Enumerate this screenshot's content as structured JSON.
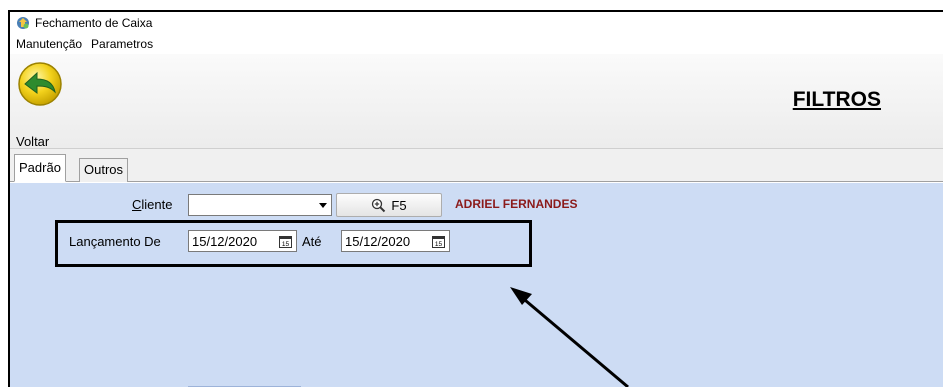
{
  "window": {
    "title": "Fechamento de Caixa"
  },
  "menu": {
    "items": [
      "Manutenção",
      "Parametros"
    ]
  },
  "toolbar": {
    "back_label": "Voltar",
    "back_icon": "back-arrow-icon",
    "page_title": "FILTROS"
  },
  "tabs": [
    {
      "label": "Padrão",
      "active": true
    },
    {
      "label": "Outros",
      "active": false
    }
  ],
  "filters": {
    "cliente_label": "Cliente",
    "cliente_value": "",
    "search_button_label": "F5",
    "search_icon": "magnifier-plus-icon",
    "cliente_name": "ADRIEL FERNANDES",
    "lancamento_label": "Lançamento De",
    "date_from": "15/12/2020",
    "ate_label": "Até",
    "date_to": "15/12/2020",
    "calendar_icon": "calendar-icon"
  },
  "colors": {
    "panel_background": "#cddcf4",
    "client_name": "#8b1a1a",
    "back_button_yellow": "#f3d21c",
    "back_arrow_green": "#2e8b2e"
  }
}
